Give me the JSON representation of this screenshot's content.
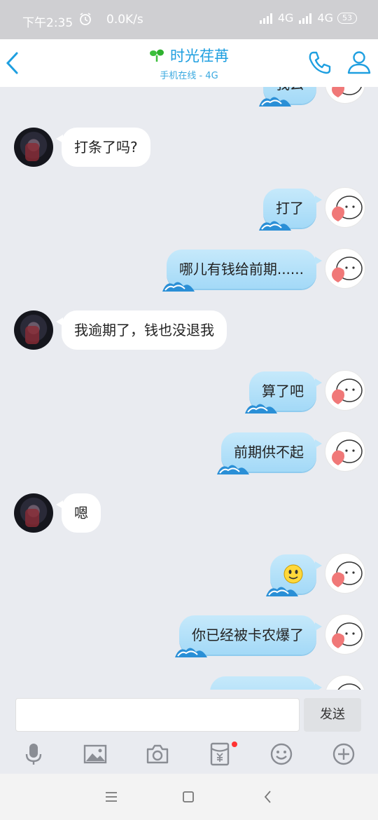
{
  "status_bar": {
    "time": "下午2:35",
    "speed": "0.0K/s",
    "network1": "4G",
    "network2": "4G",
    "battery": "53"
  },
  "header": {
    "title": "时光荏苒",
    "subtitle": "手机在线 - 4G"
  },
  "messages": [
    {
      "side": "right",
      "text": "我么"
    },
    {
      "side": "left",
      "text": "打条了吗?"
    },
    {
      "side": "right",
      "text": "打了"
    },
    {
      "side": "right",
      "text": "哪儿有钱给前期......"
    },
    {
      "side": "left",
      "text": "我逾期了，钱也没退我"
    },
    {
      "side": "right",
      "text": "算了吧"
    },
    {
      "side": "right",
      "text": "前期供不起"
    },
    {
      "side": "left",
      "text": "嗯"
    },
    {
      "side": "right",
      "text": "",
      "emoji": "smile-emoji"
    },
    {
      "side": "right",
      "text": "你已经被卡农爆了"
    },
    {
      "side": "right",
      "text": ""
    }
  ],
  "input": {
    "placeholder": ""
  },
  "send_label": "发送",
  "colors": {
    "accent": "#1e9fe0",
    "bubble_right": "#b3e0f9",
    "bubble_left": "#ffffff",
    "background": "#e9ebf0"
  },
  "toolbar_icons": [
    "mic-icon",
    "image-icon",
    "camera-icon",
    "red-packet-icon",
    "emoji-icon",
    "plus-icon"
  ]
}
